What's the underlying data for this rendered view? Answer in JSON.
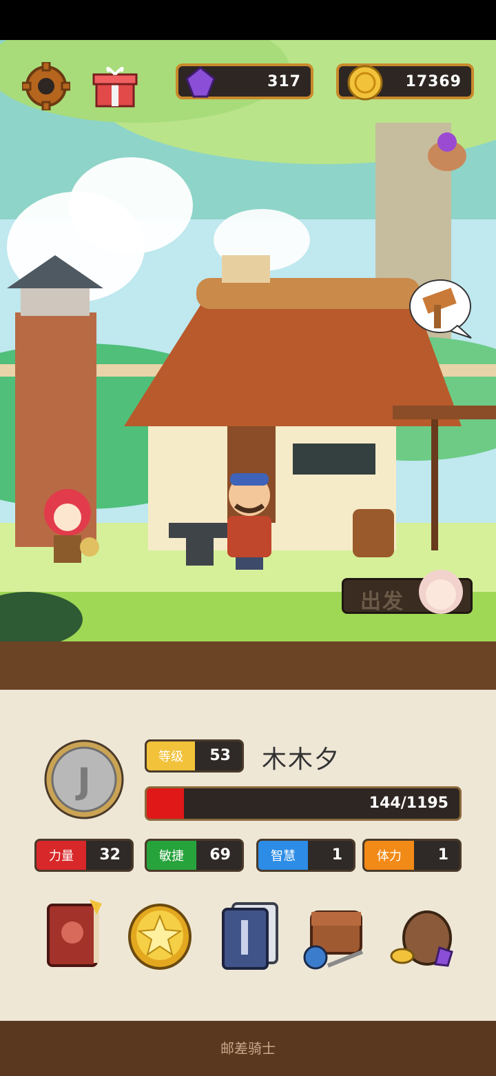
{
  "hud": {
    "gems": "317",
    "gold": "17369"
  },
  "scene": {
    "depart_label": "出发"
  },
  "character": {
    "level_label": "等级",
    "level": "53",
    "name": "木木夕",
    "hp": "144/1195",
    "hp_fraction": 0.12
  },
  "stats": [
    {
      "label": "力量",
      "value": "32",
      "color": "#d8282a"
    },
    {
      "label": "敏捷",
      "value": "69",
      "color": "#27a33c"
    },
    {
      "label": "智慧",
      "value": "1",
      "color": "#2c8ce6"
    },
    {
      "label": "体力",
      "value": "1",
      "color": "#f28a17"
    }
  ],
  "menu_icons": [
    "journal-book-icon",
    "star-coin-icon",
    "card-deck-icon",
    "inventory-bag-icon",
    "treasure-sack-icon"
  ],
  "footer": {
    "title": "邮差骑士"
  },
  "colors": {
    "gold": "#c98a2b",
    "panel_bg": "#efe7d6",
    "wood": "#5a3820"
  }
}
